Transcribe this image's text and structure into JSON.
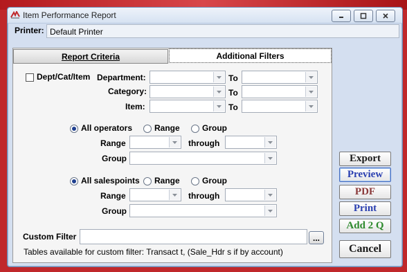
{
  "window": {
    "title": "Item Performance Report",
    "controls": [
      "minimize-icon",
      "maximize-icon",
      "close-icon"
    ]
  },
  "printer": {
    "label": "Printer:",
    "value": "Default Printer"
  },
  "tabs": [
    {
      "label": "Report Criteria",
      "active": false
    },
    {
      "label": "Additional Filters",
      "active": true
    }
  ],
  "dept_filter": {
    "checkbox_label": "Dept/Cat/Item",
    "checked": false,
    "rows": [
      {
        "label": "Department:",
        "to": "To"
      },
      {
        "label": "Category:",
        "to": "To"
      },
      {
        "label": "Item:",
        "to": "To"
      }
    ]
  },
  "operators": {
    "options": [
      "All operators",
      "Range",
      "Group"
    ],
    "selected": "All operators",
    "range_label": "Range",
    "through_label": "through",
    "group_label": "Group"
  },
  "salespoints": {
    "options": [
      "All salespoints",
      "Range",
      "Group"
    ],
    "selected": "All salespoints",
    "range_label": "Range",
    "through_label": "through",
    "group_label": "Group"
  },
  "custom_filter": {
    "label": "Custom Filter",
    "value": "",
    "browse_label": "...",
    "note": "Tables available for custom filter: Transact t,  (Sale_Hdr s if by account)"
  },
  "side_buttons": [
    {
      "label": "Export",
      "color": "#1a1a1a"
    },
    {
      "label": "Preview",
      "color": "#2a3fb0"
    },
    {
      "label": "PDF",
      "color": "#8a3a3a"
    },
    {
      "label": "Print",
      "color": "#2a3fb0"
    },
    {
      "label": "Add 2 Q",
      "color": "#2d8a2d"
    },
    {
      "label": "Cancel",
      "color": "#1a1a1a"
    }
  ]
}
